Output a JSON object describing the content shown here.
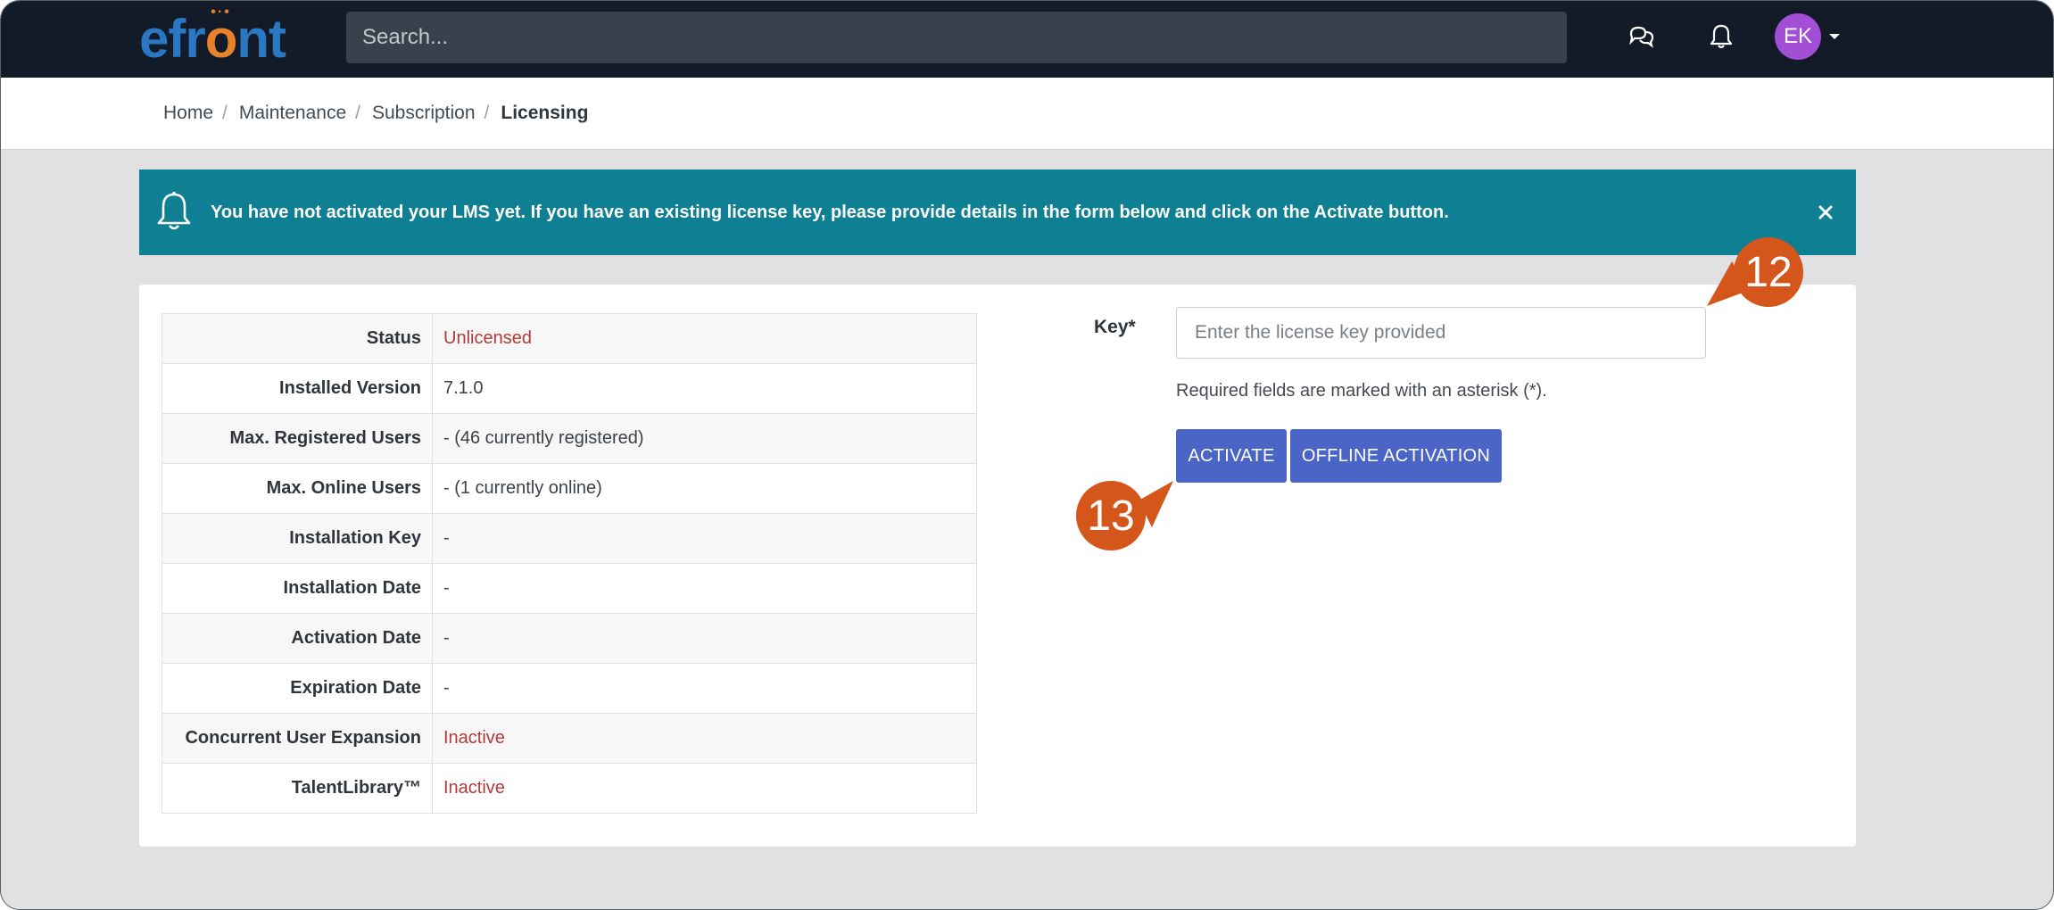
{
  "app": {
    "logo_text_pre": "efr",
    "logo_text_o": "o",
    "logo_text_post": "nt"
  },
  "navbar": {
    "search_placeholder": "Search...",
    "avatar_initials": "EK"
  },
  "breadcrumb": {
    "items": [
      "Home",
      "Maintenance",
      "Subscription"
    ],
    "current": "Licensing"
  },
  "alert": {
    "message": "You have not activated your LMS yet. If you have an existing license key, please provide details in the form below and click on the Activate button."
  },
  "license_table": {
    "rows": [
      {
        "label": "Status",
        "value": "Unlicensed",
        "status": "error"
      },
      {
        "label": "Installed Version",
        "value": "7.1.0",
        "status": "normal"
      },
      {
        "label": "Max. Registered Users",
        "value": "- (46 currently registered)",
        "status": "normal"
      },
      {
        "label": "Max. Online Users",
        "value": "- (1 currently online)",
        "status": "normal"
      },
      {
        "label": "Installation Key",
        "value": "-",
        "status": "normal"
      },
      {
        "label": "Installation Date",
        "value": "-",
        "status": "normal"
      },
      {
        "label": "Activation Date",
        "value": "-",
        "status": "normal"
      },
      {
        "label": "Expiration Date",
        "value": "-",
        "status": "normal"
      },
      {
        "label": "Concurrent User Expansion",
        "value": "Inactive",
        "status": "error"
      },
      {
        "label": "TalentLibrary™",
        "value": "Inactive",
        "status": "error"
      }
    ]
  },
  "form": {
    "key_label": "Key*",
    "key_placeholder": "Enter the license key provided",
    "key_value": "",
    "required_note": "Required fields are marked with an asterisk (*).",
    "activate_label": "ACTIVATE",
    "offline_label": "OFFLINE ACTIVATION"
  },
  "callouts": {
    "first": "12",
    "second": "13"
  },
  "colors": {
    "navbar": "#121b27",
    "alert": "#0f7f93",
    "primary_button": "#4a65c6",
    "error_text": "#b33a3a",
    "callout": "#d4561a",
    "avatar": "#a24fd6"
  }
}
